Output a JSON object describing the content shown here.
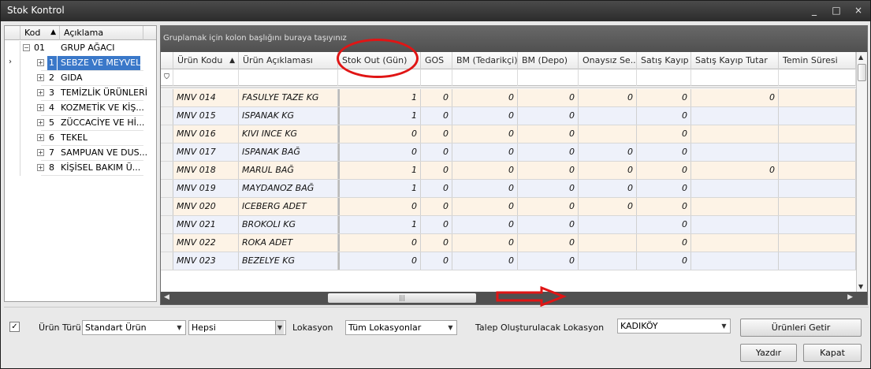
{
  "window": {
    "title": "Stok Kontrol",
    "controls": [
      "_",
      "□",
      "×"
    ]
  },
  "tree": {
    "headers": {
      "code": "Kod",
      "sort": "▲",
      "desc": "Açıklama"
    },
    "root": {
      "code": "01",
      "label": "GRUP AĞACI"
    },
    "items": [
      {
        "code": "1",
        "label": "SEBZE VE MEYVELER",
        "selected": true
      },
      {
        "code": "2",
        "label": "GIDA"
      },
      {
        "code": "3",
        "label": "TEMİZLİK ÜRÜNLERİ"
      },
      {
        "code": "4",
        "label": "KOZMETİK VE KİŞ..."
      },
      {
        "code": "5",
        "label": "ZÜCCACİYE VE Hİ..."
      },
      {
        "code": "6",
        "label": "TEKEL"
      },
      {
        "code": "7",
        "label": "SAMPUAN VE DUS..."
      },
      {
        "code": "8",
        "label": "KİŞİSEL BAKIM Ü..."
      }
    ]
  },
  "grid": {
    "group_panel_text": "Gruplamak için kolon başlığını buraya taşıyınız",
    "columns": [
      {
        "label": "Ürün Kodu",
        "sort": "▲"
      },
      {
        "label": "Ürün Açıklaması"
      },
      {
        "label": "Stok Out (Gün)"
      },
      {
        "label": "GOS"
      },
      {
        "label": "BM (Tedarikçi)"
      },
      {
        "label": "BM (Depo)"
      },
      {
        "label": "Onaysız Se..."
      },
      {
        "label": "Satış Kayıp"
      },
      {
        "label": "Satış Kayıp Tutar"
      },
      {
        "label": "Temin Süresi"
      }
    ],
    "rows": [
      {
        "code": "MNV 014",
        "desc": "FASULYE TAZE KG",
        "stok_out": "1",
        "gos": "0",
        "bm_ted": "0",
        "bm_depo": "0",
        "onaysiz": "0",
        "satis_kayip": "0",
        "kayip_tutar": "0",
        "temin": ""
      },
      {
        "code": "MNV 015",
        "desc": "ISPANAK  KG",
        "stok_out": "1",
        "gos": "0",
        "bm_ted": "0",
        "bm_depo": "0",
        "onaysiz": "",
        "satis_kayip": "0",
        "kayip_tutar": "",
        "temin": ""
      },
      {
        "code": "MNV 016",
        "desc": "KIVI INCE KG",
        "stok_out": "0",
        "gos": "0",
        "bm_ted": "0",
        "bm_depo": "0",
        "onaysiz": "",
        "satis_kayip": "0",
        "kayip_tutar": "",
        "temin": ""
      },
      {
        "code": "MNV 017",
        "desc": "ISPANAK BAĞ",
        "stok_out": "0",
        "gos": "0",
        "bm_ted": "0",
        "bm_depo": "0",
        "onaysiz": "0",
        "satis_kayip": "0",
        "kayip_tutar": "",
        "temin": ""
      },
      {
        "code": "MNV 018",
        "desc": "MARUL BAĞ",
        "stok_out": "1",
        "gos": "0",
        "bm_ted": "0",
        "bm_depo": "0",
        "onaysiz": "0",
        "satis_kayip": "0",
        "kayip_tutar": "0",
        "temin": ""
      },
      {
        "code": "MNV 019",
        "desc": "MAYDANOZ BAĞ",
        "stok_out": "1",
        "gos": "0",
        "bm_ted": "0",
        "bm_depo": "0",
        "onaysiz": "0",
        "satis_kayip": "0",
        "kayip_tutar": "",
        "temin": ""
      },
      {
        "code": "MNV 020",
        "desc": "ICEBERG ADET",
        "stok_out": "0",
        "gos": "0",
        "bm_ted": "0",
        "bm_depo": "0",
        "onaysiz": "0",
        "satis_kayip": "0",
        "kayip_tutar": "",
        "temin": ""
      },
      {
        "code": "MNV 021",
        "desc": "BROKOLI KG",
        "stok_out": "1",
        "gos": "0",
        "bm_ted": "0",
        "bm_depo": "0",
        "onaysiz": "",
        "satis_kayip": "0",
        "kayip_tutar": "",
        "temin": ""
      },
      {
        "code": "MNV 022",
        "desc": "ROKA ADET",
        "stok_out": "0",
        "gos": "0",
        "bm_ted": "0",
        "bm_depo": "0",
        "onaysiz": "",
        "satis_kayip": "0",
        "kayip_tutar": "",
        "temin": ""
      },
      {
        "code": "MNV 023",
        "desc": "BEZELYE  KG",
        "stok_out": "0",
        "gos": "0",
        "bm_ted": "0",
        "bm_depo": "0",
        "onaysiz": "",
        "satis_kayip": "0",
        "kayip_tutar": "",
        "temin": ""
      }
    ],
    "filter_icon": "filter-icon",
    "hscroll_grip": "|||"
  },
  "annotations": {
    "color": "#e01515",
    "ellipse_target": "Stok Out (Gün)",
    "arrow": "right-arrow"
  },
  "bottom": {
    "checkbox_checked": "✓",
    "urun_turu_label": "Ürün Türü",
    "urun_turu_value": "Standart Ürün",
    "hepsi_value": "Hepsi",
    "lokasyon_label": "Lokasyon",
    "lokasyon_value": "Tüm Lokasyonlar",
    "talep_label": "Talep Oluşturulacak Lokasyon",
    "talep_value": "KADIKÖY",
    "getir_button": "Ürünleri Getir",
    "yazdir_button": "Yazdır",
    "kapat_button": "Kapat"
  },
  "colors": {
    "titlebar": "#2b2b2b",
    "selection": "#3a78c9",
    "row_odd": "#fdf3e6",
    "row_even": "#eef1fa"
  }
}
